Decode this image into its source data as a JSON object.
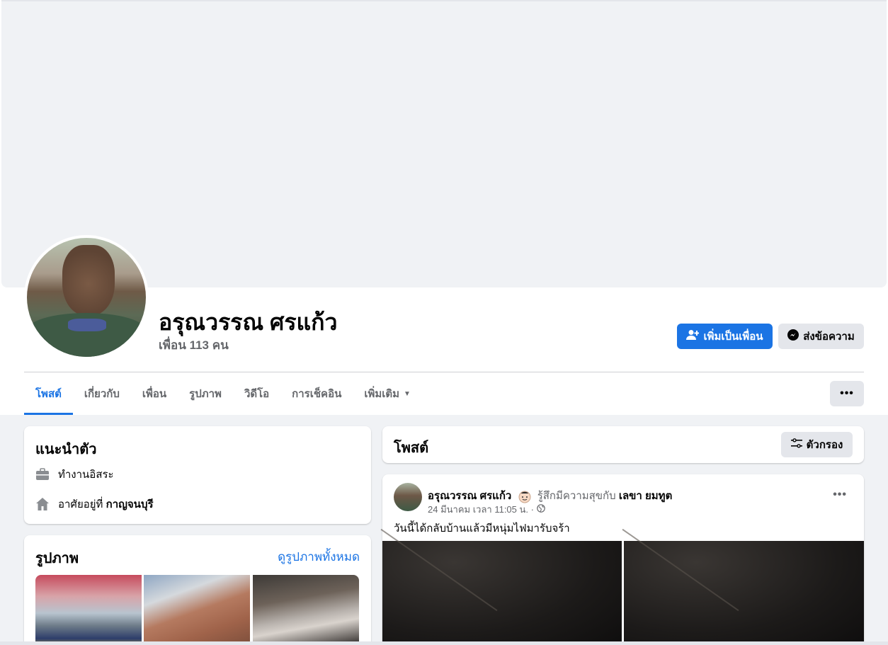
{
  "profile": {
    "name": "อรุณวรรณ ศรแก้ว",
    "friends_count": "เพื่อน 113 คน",
    "add_friend_label": "เพิ่มเป็นเพื่อน",
    "message_label": "ส่งข้อความ"
  },
  "tabs": [
    {
      "label": "โพสต์",
      "active": true
    },
    {
      "label": "เกี่ยวกับ"
    },
    {
      "label": "เพื่อน"
    },
    {
      "label": "รูปภาพ"
    },
    {
      "label": "วิดีโอ"
    },
    {
      "label": "การเช็คอิน"
    },
    {
      "label": "เพิ่มเติม"
    }
  ],
  "more_button_icon": "ellipsis-icon",
  "intro": {
    "title": "แนะนำตัว",
    "work": "ทำงานอิสระ",
    "lives_in_prefix": "อาศัยอยู่ที่",
    "lives_in_place": "กาญจนบุรี"
  },
  "photos": {
    "title": "รูปภาพ",
    "see_all": "ดูรูปภาพทั้งหมด"
  },
  "posts_header": {
    "title": "โพสต์",
    "filter_label": "ตัวกรอง"
  },
  "post": {
    "author": "อรุณวรรณ ศรแก้ว",
    "feeling": "รู้สึกมีความสุขกับ",
    "tagged": "เลขา ยมทูต",
    "time": "24 มีนาคม เวลา 11:05 น. ·",
    "text": "วันนี้ได้กลับบ้านแล้วมีหนุ่มไฟมารับจร้า"
  },
  "colors": {
    "accent": "#1b74e4",
    "secondary_button": "#e4e6eb",
    "page_bg": "#f0f2f5"
  }
}
